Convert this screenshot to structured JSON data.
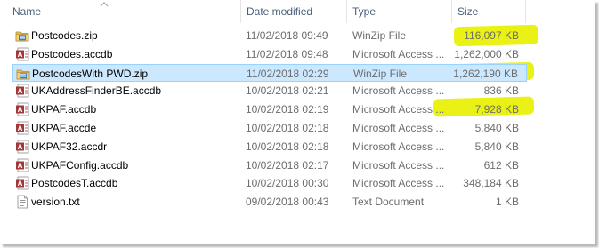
{
  "columns": {
    "name": "Name",
    "date_modified": "Date modified",
    "type": "Type",
    "size": "Size"
  },
  "highlight_color": "#e8f000",
  "selection_color": "#cce8ff",
  "files": [
    {
      "name": "Postcodes.zip",
      "date": "11/02/2018 09:49",
      "type": "WinZip File",
      "size": "116,097 KB",
      "icon": "winzip-icon",
      "highlighted": true,
      "selected": false
    },
    {
      "name": "Postcodes.accdb",
      "date": "11/02/2018 09:48",
      "type": "Microsoft Access ...",
      "size": "1,262,000 KB",
      "icon": "access-icon",
      "highlighted": true,
      "selected": false
    },
    {
      "name": "PostcodesWith PWD.zip",
      "date": "11/02/2018 02:29",
      "type": "WinZip File",
      "size": "1,262,190 KB",
      "icon": "winzip-icon",
      "highlighted": true,
      "selected": true
    },
    {
      "name": "UKAddressFinderBE.accdb",
      "date": "10/02/2018 02:21",
      "type": "Microsoft Access ...",
      "size": "836 KB",
      "icon": "access-icon",
      "highlighted": false,
      "selected": false
    },
    {
      "name": "UKPAF.accdb",
      "date": "10/02/2018 02:19",
      "type": "Microsoft Access ...",
      "size": "7,928 KB",
      "icon": "access-icon",
      "highlighted": false,
      "selected": false
    },
    {
      "name": "UKPAF.accde",
      "date": "10/02/2018 02:18",
      "type": "Microsoft Access ...",
      "size": "5,840 KB",
      "icon": "access-icon",
      "highlighted": false,
      "selected": false
    },
    {
      "name": "UKPAF32.accdr",
      "date": "10/02/2018 02:18",
      "type": "Microsoft Access ...",
      "size": "5,840 KB",
      "icon": "access-icon",
      "highlighted": false,
      "selected": false
    },
    {
      "name": "UKPAFConfig.accdb",
      "date": "10/02/2018 02:17",
      "type": "Microsoft Access ...",
      "size": "612 KB",
      "icon": "access-icon",
      "highlighted": false,
      "selected": false
    },
    {
      "name": "PostcodesT.accdb",
      "date": "10/02/2018 00:30",
      "type": "Microsoft Access ...",
      "size": "348,184 KB",
      "icon": "access-icon",
      "highlighted": false,
      "selected": false
    },
    {
      "name": "version.txt",
      "date": "09/02/2018 00:43",
      "type": "Text Document",
      "size": "1 KB",
      "icon": "text-file-icon",
      "highlighted": false,
      "selected": false
    }
  ]
}
